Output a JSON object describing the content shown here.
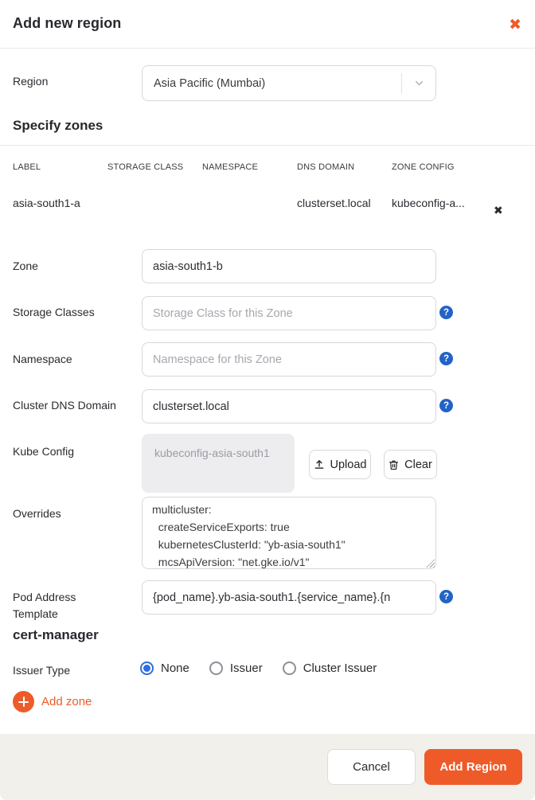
{
  "modal": {
    "title": "Add new region",
    "close_icon": "✖"
  },
  "region_field": {
    "label": "Region",
    "value": "Asia Pacific (Mumbai)"
  },
  "zones_section": {
    "heading": "Specify zones",
    "table": {
      "columns": [
        "LABEL",
        "STORAGE CLASS",
        "NAMESPACE",
        "DNS DOMAIN",
        "ZONE CONFIG"
      ],
      "rows": [
        {
          "label": "asia-south1-a",
          "storage_class": "",
          "namespace": "",
          "dns_domain": "clusterset.local",
          "zone_config": "kubeconfig-a...",
          "delete_icon": "✖"
        }
      ]
    },
    "form": {
      "zone": {
        "label": "Zone",
        "value": "asia-south1-b"
      },
      "storage_classes": {
        "label": "Storage Classes",
        "placeholder": "Storage Class for this Zone"
      },
      "namespace": {
        "label": "Namespace",
        "placeholder": "Namespace for this Zone"
      },
      "dns_domain": {
        "label": "Cluster DNS Domain",
        "value": "clusterset.local"
      },
      "kube_config": {
        "label": "Kube Config",
        "file_name": "kubeconfig-asia-south1",
        "upload_label": "Upload",
        "clear_label": "Clear"
      },
      "overrides": {
        "label": "Overrides",
        "value": "multicluster:\n  createServiceExports: true\n  kubernetesClusterId: \"yb-asia-south1\"\n  mcsApiVersion: \"net.gke.io/v1\""
      },
      "pod_address": {
        "label": "Pod Address Template",
        "value": "{pod_name}.yb-asia-south1.{service_name}.{n"
      }
    },
    "cert_manager": {
      "heading": "cert-manager",
      "issuer_type": {
        "label": "Issuer Type",
        "options": [
          "None",
          "Issuer",
          "Cluster Issuer"
        ],
        "selected": "None"
      }
    },
    "add_zone_label": "Add zone"
  },
  "footer": {
    "cancel_label": "Cancel",
    "submit_label": "Add Region"
  },
  "colors": {
    "accent_orange": "#ee5b28",
    "help_blue": "#2263c7",
    "radio_blue": "#2f6de0",
    "footer_background": "#f1f0eb"
  }
}
